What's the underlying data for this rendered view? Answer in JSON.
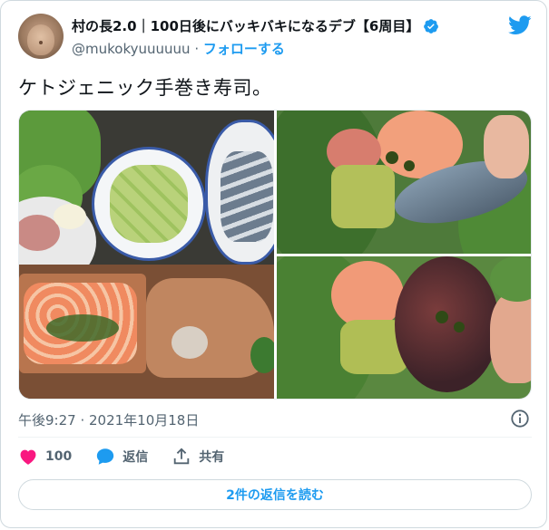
{
  "user": {
    "display_name": "村の長2.0｜100日後にバッキバキになるデブ【6周目】",
    "handle": "@mukokyuuuuuu",
    "separator": "·",
    "follow_label": "フォローする"
  },
  "tweet": {
    "text": "ケトジェニック手巻き寿司。",
    "timestamp": "午後9:27 · 2021年10月18日"
  },
  "actions": {
    "like_count": "100",
    "reply_label": "返信",
    "share_label": "共有"
  },
  "replies_button": "2件の返信を読む",
  "colors": {
    "accent": "#1d9bf0",
    "like": "#f91880",
    "secondary_text": "#536471"
  }
}
